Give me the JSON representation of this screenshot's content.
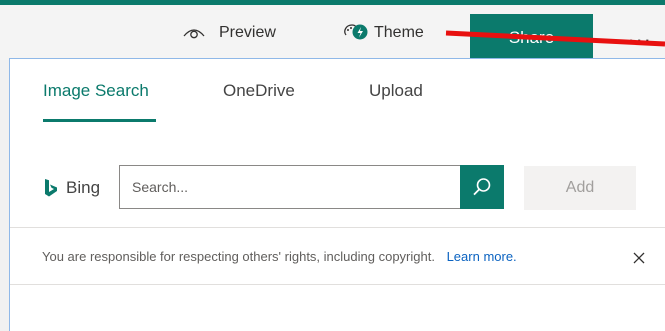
{
  "toolbar": {
    "preview_label": "Preview",
    "preview_icon": "eye-icon",
    "theme_label": "Theme",
    "theme_icon": "palette-icon",
    "share_label": "Share",
    "more_label": "...",
    "accent": "#0b7a6c"
  },
  "panel": {
    "tabs": [
      {
        "label": "Image Search",
        "selected": true
      },
      {
        "label": "OneDrive",
        "selected": false
      },
      {
        "label": "Upload",
        "selected": false
      }
    ],
    "bing_label": "Bing",
    "search": {
      "placeholder": "Search...",
      "value": ""
    },
    "add_label": "Add",
    "notice": {
      "text": "You are responsible for respecting others' rights, including copyright.",
      "link": "Learn more."
    }
  }
}
